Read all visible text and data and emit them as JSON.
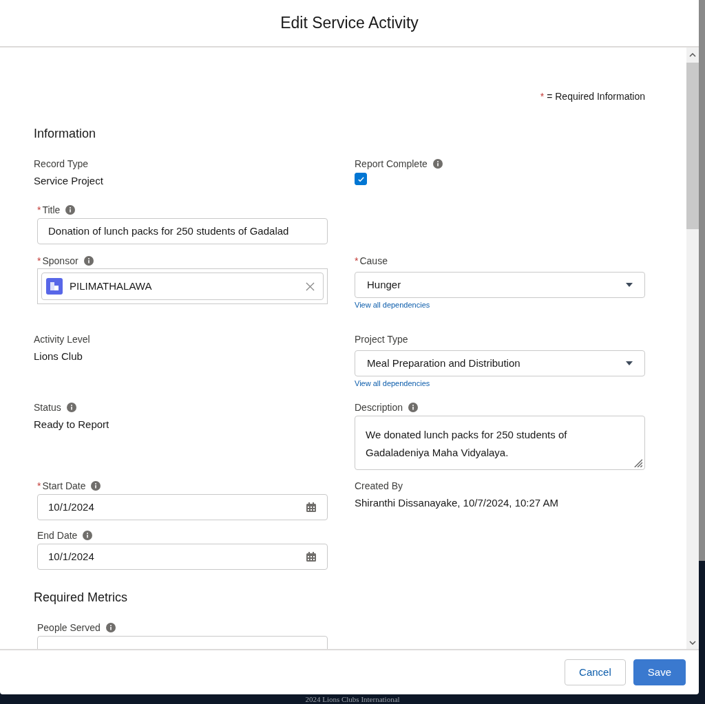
{
  "modal": {
    "title": "Edit Service Activity"
  },
  "required_note": {
    "marker": "*",
    "text": "= Required Information"
  },
  "sections": [
    {
      "heading": "Information",
      "rows": [
        {
          "left": {
            "kind": "readonly",
            "label": "Record Type",
            "value": "Service Project"
          },
          "right": {
            "kind": "checkbox",
            "label": "Report Complete",
            "info": true,
            "checked": true
          }
        },
        {
          "left": {
            "kind": "input",
            "label": "Title",
            "required": true,
            "info": true,
            "value": "Donation of lunch packs for 250 students of Gadalad"
          }
        },
        {
          "left": {
            "kind": "lookup",
            "label": "Sponsor",
            "required": true,
            "info": true,
            "value": "PILIMATHALAWA"
          },
          "right": {
            "kind": "picklist",
            "label": "Cause",
            "required": true,
            "value": "Hunger",
            "link": "View all dependencies"
          }
        },
        {
          "left": {
            "kind": "readonly",
            "label": "Activity Level",
            "value": "Lions Club"
          },
          "right": {
            "kind": "picklist",
            "label": "Project Type",
            "value": "Meal Preparation and Distribution",
            "link": "View all dependencies"
          }
        },
        {
          "left": {
            "kind": "readonly",
            "label": "Status",
            "info": true,
            "value": "Ready to Report"
          },
          "right": {
            "kind": "textarea",
            "label": "Description",
            "info": true,
            "value": "We donated lunch packs for 250 students of Gadaladeniya Maha Vidyalaya."
          }
        },
        {
          "left": {
            "kind": "date",
            "label": "Start Date",
            "required": true,
            "info": true,
            "value": "10/1/2024"
          },
          "right": {
            "kind": "readonly",
            "label": "Created By",
            "value": "Shiranthi Dissanayake, 10/7/2024, 10:27 AM"
          }
        },
        {
          "left": {
            "kind": "date",
            "label": "End Date",
            "info": true,
            "value": "10/1/2024"
          }
        }
      ]
    },
    {
      "heading": "Required Metrics",
      "rows": [
        {
          "left": {
            "kind": "input",
            "label": "People Served",
            "info": true
          }
        }
      ]
    }
  ],
  "footer": {
    "buttons": [
      {
        "label": "Cancel",
        "kind": "neutral"
      },
      {
        "label": "Save",
        "kind": "brand"
      }
    ]
  },
  "page_footer": {
    "text": "2024 Lions Clubs International"
  }
}
